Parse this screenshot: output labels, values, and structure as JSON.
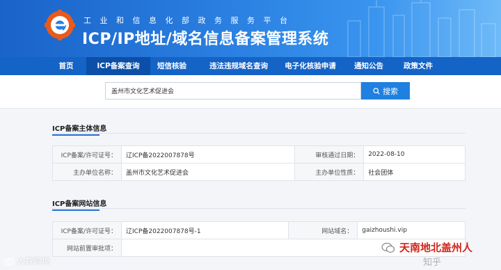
{
  "header": {
    "subtitle": "工业和信息化部政务服务平台",
    "title": "ICP/IP地址/域名信息备案管理系统"
  },
  "nav": {
    "items": [
      {
        "label": "首页"
      },
      {
        "label": "ICP备案查询"
      },
      {
        "label": "短信核验"
      },
      {
        "label": "违法违规域名查询"
      },
      {
        "label": "电子化核验申请"
      },
      {
        "label": "通知公告"
      },
      {
        "label": "政策文件"
      }
    ],
    "active_index": 1
  },
  "search": {
    "value": "盖州市文化艺术促进会",
    "button_label": "搜索"
  },
  "sections": [
    {
      "title": "ICP备案主体信息",
      "rows": [
        {
          "label1": "ICP备案/许可证号：",
          "value1": "辽ICP备2022007878号",
          "label2": "审核通过日期：",
          "value2": "2022-08-10"
        },
        {
          "label1": "主办单位名称：",
          "value1": "盖州市文化艺术促进会",
          "label2": "主办单位性质：",
          "value2": "社会团体"
        }
      ]
    },
    {
      "title": "ICP备案网站信息",
      "rows": [
        {
          "label1": "ICP备案/许可证号：",
          "value1": "辽ICP备2022007878号-1",
          "label2": "网站域名：",
          "value2": "gaizhoushi.vip"
        },
        {
          "label1": "网站前置审批项：",
          "value1": ""
        }
      ]
    }
  ],
  "watermarks": {
    "left": "大数跨境",
    "right": "天南地北盖州人",
    "zhihu": "知乎"
  },
  "colors": {
    "banner": "#1a63c9",
    "nav": "#1463c7",
    "nav_active": "#0b4fa8",
    "search_button": "#1f80e0",
    "accent_underline": "#1f6fd6"
  }
}
